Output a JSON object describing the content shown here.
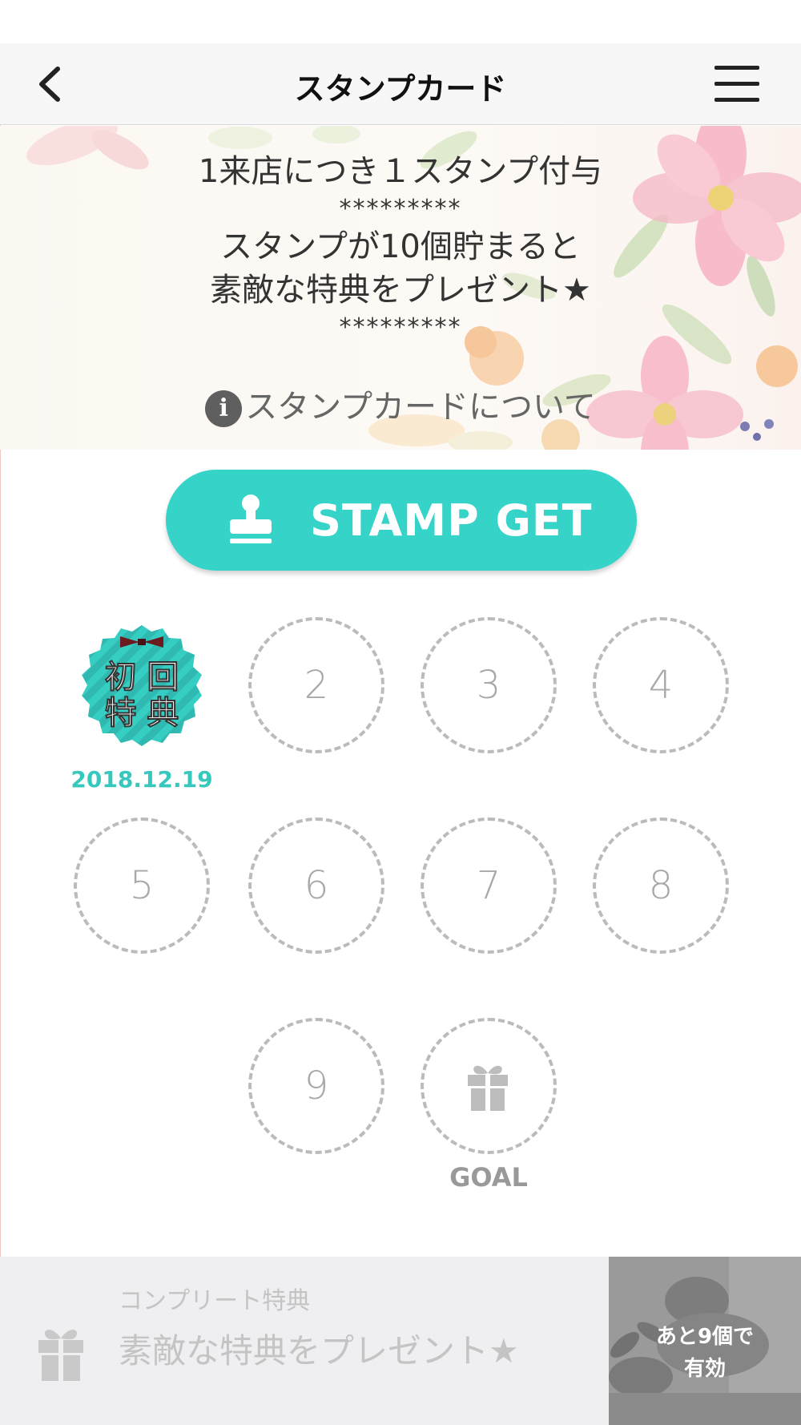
{
  "nav": {
    "title": "スタンプカード",
    "back_icon": "chevron-left-icon",
    "menu_icon": "hamburger-menu-icon"
  },
  "hero": {
    "line1": "1来店につき１スタンプ付与",
    "stars1": "*********",
    "line2a": "スタンプが10個貯まると",
    "line2b": "素敵な特典をプレゼント★",
    "stars2": "*********",
    "about_link": "スタンプカードについて",
    "info_icon_glyph": "i"
  },
  "stamp_button": {
    "label": "STAMP GET",
    "color": "#36d3c9"
  },
  "stamps": {
    "first": {
      "line1": "初 回",
      "line2": "特 典",
      "date": "2018.12.19"
    },
    "numbers": [
      "2",
      "3",
      "4",
      "5",
      "6",
      "7",
      "8",
      "9"
    ],
    "goal_label": "GOAL"
  },
  "complete": {
    "label": "コンプリート特典",
    "text": "素敵な特典をプレゼント★",
    "side_line1": "あと9個で",
    "side_line2": "有効"
  },
  "colors": {
    "accent": "#36d3c9",
    "date": "#36c8bd"
  }
}
